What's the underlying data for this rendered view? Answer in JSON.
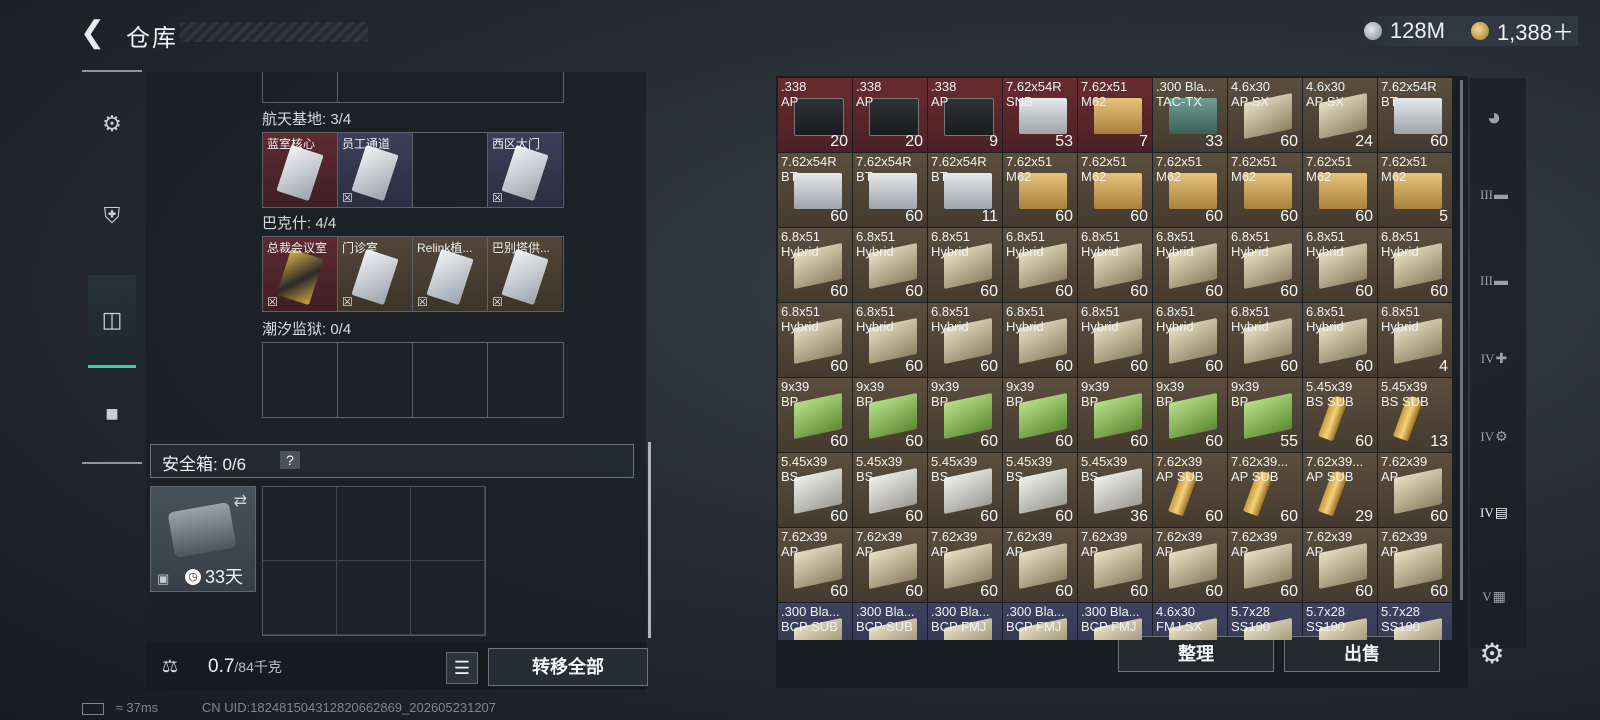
{
  "header": {
    "back_icon": "chevron-left-icon",
    "title": "仓库"
  },
  "currency": [
    {
      "icon": "silver-coin-icon",
      "value": "128M"
    },
    {
      "icon": "gold-coin-icon",
      "value": "1,388＋"
    }
  ],
  "left_nav": [
    {
      "icon": "pistol-icon"
    },
    {
      "icon": "armor-icon"
    },
    {
      "icon": "backpack-icon",
      "active": true
    },
    {
      "icon": "briefcase-icon"
    }
  ],
  "key_sections": [
    {
      "label": "航天基地: 3/4",
      "cards": [
        {
          "name": "蓝室核心",
          "color": "red",
          "card": "silver",
          "nouse": false
        },
        {
          "name": "员工通道",
          "color": "blue",
          "card": "silver",
          "nouse": true
        },
        {
          "name": "",
          "color": "empty"
        },
        {
          "name": "西区大门",
          "color": "blue",
          "card": "silver",
          "nouse": true
        }
      ]
    },
    {
      "label": "巴克什: 4/4",
      "cards": [
        {
          "name": "总裁会议室",
          "color": "red",
          "card": "gold",
          "nouse": true
        },
        {
          "name": "门诊室",
          "color": "tan",
          "card": "silver",
          "nouse": true
        },
        {
          "name": "Relink植...",
          "color": "tan",
          "card": "silver",
          "nouse": true
        },
        {
          "name": "巴别塔供...",
          "color": "tan",
          "card": "silver",
          "nouse": true
        }
      ]
    },
    {
      "label": "潮汐监狱: 0/4",
      "cards": [
        {
          "name": "",
          "color": "empty"
        },
        {
          "name": "",
          "color": "empty"
        },
        {
          "name": "",
          "color": "empty"
        },
        {
          "name": "",
          "color": "empty"
        }
      ]
    }
  ],
  "safe_box": {
    "label": "安全箱: 0/6",
    "help": "?",
    "days": "33天"
  },
  "bottom_left": {
    "weight": "0.7",
    "weight_max": "/84千克",
    "transfer": "转移全部"
  },
  "ammo_grid": [
    {
      "name": ".338\nAP",
      "count": "20",
      "color": "red",
      "box": "dark"
    },
    {
      "name": ".338\nAP",
      "count": "20",
      "color": "red",
      "box": "dark"
    },
    {
      "name": ".338\nAP",
      "count": "9",
      "color": "red",
      "box": "dark"
    },
    {
      "name": "7.62x54R\nSNB",
      "count": "53",
      "color": "red",
      "box": "silver"
    },
    {
      "name": "7.62x51\nM62",
      "count": "7",
      "color": "red",
      "box": "gold"
    },
    {
      "name": ".300 Bla...\nTAC-TX",
      "count": "33",
      "color": "tan",
      "box": "teal"
    },
    {
      "name": "4.6x30\nAP SX",
      "count": "60",
      "color": "tan",
      "box": "cream"
    },
    {
      "name": "4.6x30\nAP SX",
      "count": "24",
      "color": "tan",
      "box": "cream"
    },
    {
      "name": "7.62x54R\nBT",
      "count": "60",
      "color": "tan",
      "box": "silver"
    },
    {
      "name": "7.62x54R\nBT",
      "count": "60",
      "color": "tan",
      "box": "silver"
    },
    {
      "name": "7.62x54R\nBT",
      "count": "60",
      "color": "tan",
      "box": "silver"
    },
    {
      "name": "7.62x54R\nBT",
      "count": "11",
      "color": "tan",
      "box": "silver"
    },
    {
      "name": "7.62x51\nM62",
      "count": "60",
      "color": "tan",
      "box": "gold"
    },
    {
      "name": "7.62x51\nM62",
      "count": "60",
      "color": "tan",
      "box": "gold"
    },
    {
      "name": "7.62x51\nM62",
      "count": "60",
      "color": "tan",
      "box": "gold"
    },
    {
      "name": "7.62x51\nM62",
      "count": "60",
      "color": "tan",
      "box": "gold"
    },
    {
      "name": "7.62x51\nM62",
      "count": "60",
      "color": "tan",
      "box": "gold"
    },
    {
      "name": "7.62x51\nM62",
      "count": "5",
      "color": "tan",
      "box": "gold"
    },
    {
      "name": "6.8x51\nHybrid",
      "count": "60",
      "color": "tan",
      "box": "cream"
    },
    {
      "name": "6.8x51\nHybrid",
      "count": "60",
      "color": "tan",
      "box": "cream"
    },
    {
      "name": "6.8x51\nHybrid",
      "count": "60",
      "color": "tan",
      "box": "cream"
    },
    {
      "name": "6.8x51\nHybrid",
      "count": "60",
      "color": "tan",
      "box": "cream"
    },
    {
      "name": "6.8x51\nHybrid",
      "count": "60",
      "color": "tan",
      "box": "cream"
    },
    {
      "name": "6.8x51\nHybrid",
      "count": "60",
      "color": "tan",
      "box": "cream"
    },
    {
      "name": "6.8x51\nHybrid",
      "count": "60",
      "color": "tan",
      "box": "cream"
    },
    {
      "name": "6.8x51\nHybrid",
      "count": "60",
      "color": "tan",
      "box": "cream"
    },
    {
      "name": "6.8x51\nHybrid",
      "count": "60",
      "color": "tan",
      "box": "cream"
    },
    {
      "name": "6.8x51\nHybrid",
      "count": "60",
      "color": "tan",
      "box": "cream"
    },
    {
      "name": "6.8x51\nHybrid",
      "count": "60",
      "color": "tan",
      "box": "cream"
    },
    {
      "name": "6.8x51\nHybrid",
      "count": "60",
      "color": "tan",
      "box": "cream"
    },
    {
      "name": "6.8x51\nHybrid",
      "count": "60",
      "color": "tan",
      "box": "cream"
    },
    {
      "name": "6.8x51\nHybrid",
      "count": "60",
      "color": "tan",
      "box": "cream"
    },
    {
      "name": "6.8x51\nHybrid",
      "count": "60",
      "color": "tan",
      "box": "cream"
    },
    {
      "name": "6.8x51\nHybrid",
      "count": "60",
      "color": "tan",
      "box": "cream"
    },
    {
      "name": "6.8x51\nHybrid",
      "count": "60",
      "color": "tan",
      "box": "cream"
    },
    {
      "name": "6.8x51\nHybrid",
      "count": "4",
      "color": "tan",
      "box": "cream"
    },
    {
      "name": "9x39\nBP",
      "count": "60",
      "color": "tan",
      "box": "green"
    },
    {
      "name": "9x39\nBP",
      "count": "60",
      "color": "tan",
      "box": "green"
    },
    {
      "name": "9x39\nBP",
      "count": "60",
      "color": "tan",
      "box": "green"
    },
    {
      "name": "9x39\nBP",
      "count": "60",
      "color": "tan",
      "box": "green"
    },
    {
      "name": "9x39\nBP",
      "count": "60",
      "color": "tan",
      "box": "green"
    },
    {
      "name": "9x39\nBP",
      "count": "60",
      "color": "tan",
      "box": "green"
    },
    {
      "name": "9x39\nBP",
      "count": "55",
      "color": "tan",
      "box": "green"
    },
    {
      "name": "5.45x39\nBS SUB",
      "count": "60",
      "color": "tan",
      "box": "bullet"
    },
    {
      "name": "5.45x39\nBS SUB",
      "count": "13",
      "color": "tan",
      "box": "bullet"
    },
    {
      "name": "5.45x39\nBS",
      "count": "60",
      "color": "tan",
      "box": "white"
    },
    {
      "name": "5.45x39\nBS",
      "count": "60",
      "color": "tan",
      "box": "white"
    },
    {
      "name": "5.45x39\nBS",
      "count": "60",
      "color": "tan",
      "box": "white"
    },
    {
      "name": "5.45x39\nBS",
      "count": "60",
      "color": "tan",
      "box": "white"
    },
    {
      "name": "5.45x39\nBS",
      "count": "36",
      "color": "tan",
      "box": "white"
    },
    {
      "name": "7.62x39\nAP SUB",
      "count": "60",
      "color": "tan",
      "box": "bullet"
    },
    {
      "name": "7.62x39...\nAP SUB",
      "count": "60",
      "color": "tan",
      "box": "bullet"
    },
    {
      "name": "7.62x39...\nAP SUB",
      "count": "29",
      "color": "tan",
      "box": "bullet"
    },
    {
      "name": "7.62x39\nAP",
      "count": "60",
      "color": "tan",
      "box": "cream"
    },
    {
      "name": "7.62x39\nAP",
      "count": "60",
      "color": "tan",
      "box": "cream"
    },
    {
      "name": "7.62x39\nAP",
      "count": "60",
      "color": "tan",
      "box": "cream"
    },
    {
      "name": "7.62x39\nAP",
      "count": "60",
      "color": "tan",
      "box": "cream"
    },
    {
      "name": "7.62x39\nAP",
      "count": "60",
      "color": "tan",
      "box": "cream"
    },
    {
      "name": "7.62x39\nAP",
      "count": "60",
      "color": "tan",
      "box": "cream"
    },
    {
      "name": "7.62x39\nAP",
      "count": "60",
      "color": "tan",
      "box": "cream"
    },
    {
      "name": "7.62x39\nAP",
      "count": "60",
      "color": "tan",
      "box": "cream"
    },
    {
      "name": "7.62x39\nAP",
      "count": "60",
      "color": "tan",
      "box": "cream"
    },
    {
      "name": "7.62x39\nAP",
      "count": "60",
      "color": "tan",
      "box": "cream"
    },
    {
      "name": ".300 Bla...\nBCP SUB",
      "count": "",
      "color": "blue",
      "box": "cream"
    },
    {
      "name": ".300 Bla...\nBCP SUB",
      "count": "",
      "color": "blue",
      "box": "cream"
    },
    {
      "name": ".300 Bla...\nBCP FMJ",
      "count": "",
      "color": "blue",
      "box": "cream"
    },
    {
      "name": ".300 Bla...\nBCP FMJ",
      "count": "",
      "color": "blue",
      "box": "cream"
    },
    {
      "name": ".300 Bla...\nBCP FMJ",
      "count": "",
      "color": "blue",
      "box": "cream"
    },
    {
      "name": "4.6x30\nFMJ SX",
      "count": "",
      "color": "blue",
      "box": "cream"
    },
    {
      "name": "5.7x28\nSS190",
      "count": "",
      "color": "blue",
      "box": "cream"
    },
    {
      "name": "5.7x28\nSS190",
      "count": "",
      "color": "blue",
      "box": "cream"
    },
    {
      "name": "5.7x28\nSS190",
      "count": "",
      "color": "blue",
      "box": "cream"
    }
  ],
  "bottom_right": {
    "sort": "整理",
    "sell": "出售"
  },
  "right_nav": [
    {
      "icon": "helmet-icon",
      "num": ""
    },
    {
      "icon": "rifle-icon",
      "num": "III"
    },
    {
      "icon": "rifle-icon",
      "num": "III"
    },
    {
      "icon": "medkit-icon",
      "num": "IV"
    },
    {
      "icon": "gear-case-icon",
      "num": "IV"
    },
    {
      "icon": "ammo-folder-icon",
      "num": "IV"
    },
    {
      "icon": "map-icon",
      "num": "V"
    }
  ],
  "footer": {
    "ping": "37ms",
    "uid": "CN UID:182481504312820662869_202605231207"
  }
}
